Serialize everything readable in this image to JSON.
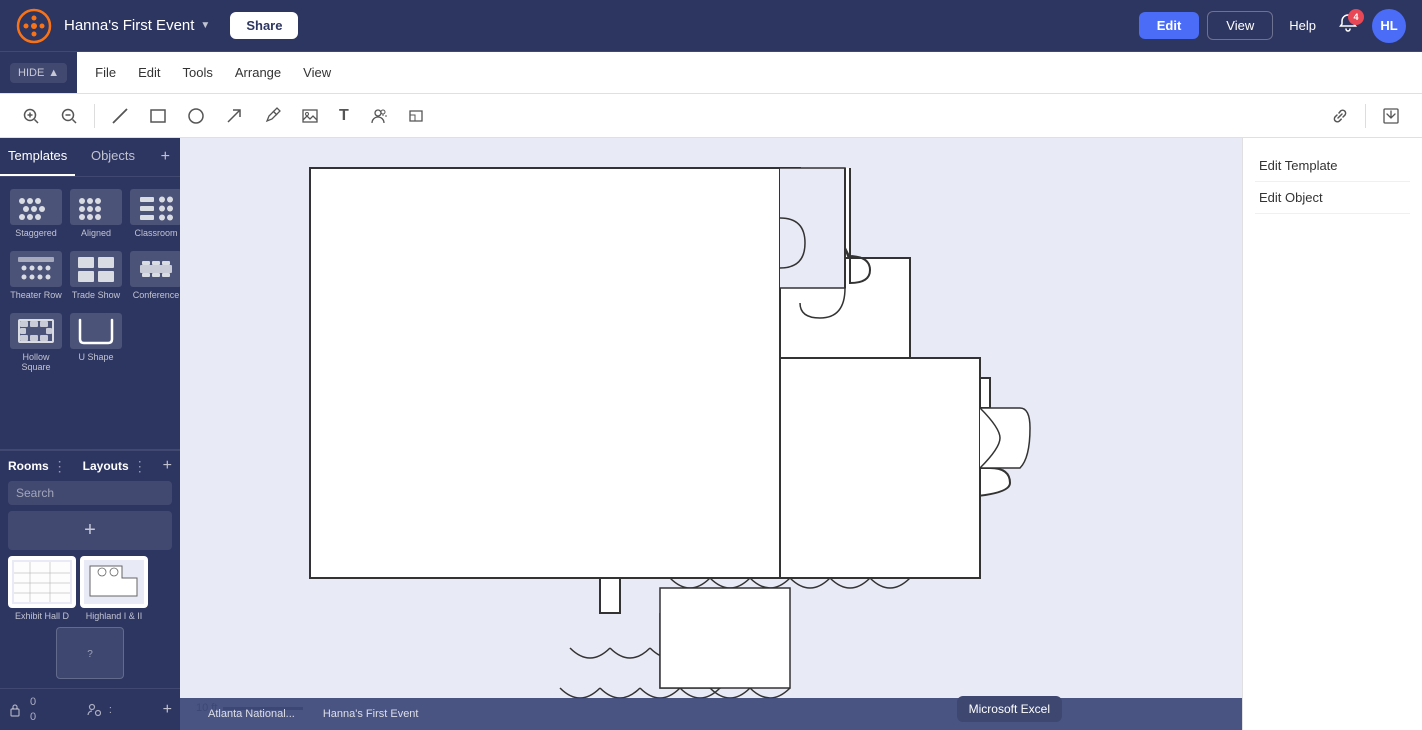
{
  "app": {
    "logo_text": "✦",
    "event_name": "Hanna's First Event",
    "share_label": "Share",
    "edit_label": "Edit",
    "view_label": "View",
    "help_label": "Help",
    "notif_count": "4",
    "avatar_initials": "HL"
  },
  "menu": {
    "items": [
      "File",
      "Edit",
      "Tools",
      "Arrange",
      "View"
    ],
    "hide_label": "HIDE"
  },
  "toolbar": {
    "tools": [
      {
        "name": "zoom-in",
        "icon": "+",
        "label": "Zoom In"
      },
      {
        "name": "zoom-out",
        "icon": "−",
        "label": "Zoom Out"
      },
      {
        "name": "line-tool",
        "icon": "╱",
        "label": "Line"
      },
      {
        "name": "rect-tool",
        "icon": "□",
        "label": "Rectangle"
      },
      {
        "name": "circle-tool",
        "icon": "○",
        "label": "Circle"
      },
      {
        "name": "arrow-tool",
        "icon": "↗",
        "label": "Arrow"
      },
      {
        "name": "pen-tool",
        "icon": "✏",
        "label": "Pen"
      },
      {
        "name": "image-tool",
        "icon": "⊞",
        "label": "Image"
      },
      {
        "name": "text-tool",
        "icon": "T",
        "label": "Text"
      },
      {
        "name": "person-tool",
        "icon": "👤",
        "label": "Person"
      },
      {
        "name": "shape-tool",
        "icon": "⊓",
        "label": "Shape"
      }
    ],
    "right_tools": [
      {
        "name": "link-icon",
        "icon": "🔗"
      },
      {
        "name": "export-icon",
        "icon": "⬜"
      }
    ]
  },
  "left_panel": {
    "tabs": [
      "Templates",
      "Objects"
    ],
    "add_label": "+",
    "templates": [
      {
        "id": "staggered",
        "label": "Staggered"
      },
      {
        "id": "aligned",
        "label": "Aligned"
      },
      {
        "id": "classroom",
        "label": "Classroom"
      },
      {
        "id": "theater-row",
        "label": "Theater Row"
      },
      {
        "id": "trade-show",
        "label": "Trade Show"
      },
      {
        "id": "conference",
        "label": "Conference"
      },
      {
        "id": "hollow-square",
        "label": "Hollow Square"
      },
      {
        "id": "u-shape",
        "label": "U Shape"
      }
    ],
    "rooms_title": "Rooms",
    "layouts_title": "Layouts",
    "search_placeholder": "Search",
    "add_room_icon": "+",
    "rooms": [
      {
        "id": "exhibit-hall-d",
        "label": "Exhibit Hall D"
      },
      {
        "id": "highland-i-ii",
        "label": "Highland I & II"
      },
      {
        "id": "unknown-room",
        "label": ""
      }
    ],
    "bottom": {
      "lock_count": "0",
      "person_count": "0"
    }
  },
  "right_panel": {
    "items": [
      "Edit Template",
      "Edit Object"
    ]
  },
  "canvas": {
    "scale_label": "10 ft"
  },
  "bottom_tabs": [
    {
      "label": "Atlanta National..."
    },
    {
      "label": "Hanna's First Event"
    }
  ],
  "tooltip": {
    "label": "Microsoft Excel"
  }
}
